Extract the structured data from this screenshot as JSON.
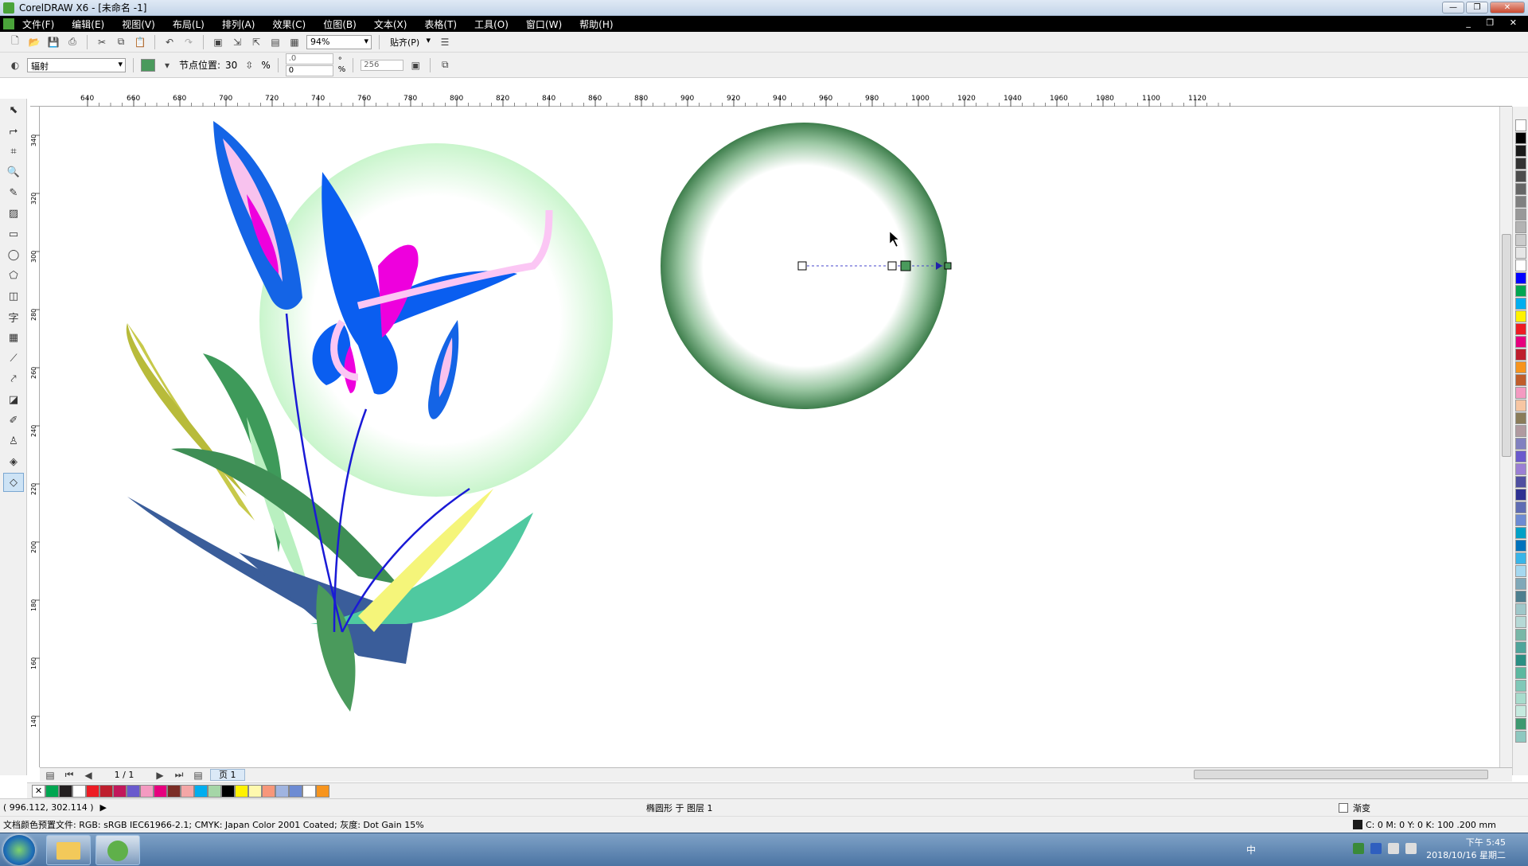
{
  "window": {
    "title": "CorelDRAW X6 - [未命名 -1]",
    "min": "—",
    "max": "❐",
    "close": "✕"
  },
  "menu": [
    "文件(F)",
    "编辑(E)",
    "视图(V)",
    "布局(L)",
    "排列(A)",
    "效果(C)",
    "位图(B)",
    "文本(X)",
    "表格(T)",
    "工具(O)",
    "窗口(W)",
    "帮助(H)"
  ],
  "menu_right": "_ ❐ ✕",
  "toolbar": {
    "zoom": "94%",
    "snap_label": "贴齐(P)"
  },
  "propbar": {
    "fill_type": "辐射",
    "node_label": "节点位置:",
    "node_value": "30",
    "pct": "%",
    "angle": ".0",
    "pad": "0",
    "pad_pct": "%",
    "steps": "256",
    "deg": "°"
  },
  "ruler": {
    "top_ticks": [
      "640",
      "660",
      "680",
      "700",
      "720",
      "740",
      "760",
      "780",
      "800",
      "820",
      "840",
      "860",
      "880",
      "900",
      "920",
      "940",
      "960",
      "980",
      "1000",
      "1020",
      "1040",
      "1060",
      "1080",
      "1100",
      "1120"
    ],
    "left_ticks": [
      "340",
      "320",
      "300",
      "280",
      "260",
      "240",
      "220",
      "200",
      "180",
      "160",
      "140"
    ]
  },
  "pagenav": {
    "counter": "1 / 1",
    "tab": "页 1"
  },
  "status": {
    "coords": "( 996.112, 302.114 )",
    "object": "椭圆形 于 图层 1",
    "fill_label": "渐变",
    "profile": "文档颜色预置文件: RGB: sRGB IEC61966-2.1; CMYK: Japan Color 2001 Coated; 灰度: Dot Gain 15%",
    "outline": "C: 0 M: 0 Y: 0 K: 100  .200 mm"
  },
  "taskbar": {
    "time": "下午 5:45",
    "date": "2018/10/16 星期二",
    "ime": "中"
  },
  "doc_palette": [
    "#00a651",
    "#231f20",
    "#ffffff",
    "#ed1c24",
    "#be1e2d",
    "#c2185b",
    "#6a5acd",
    "#f49ac1",
    "#e6007e",
    "#7b2d26",
    "#f4a6a6",
    "#00aeef",
    "#a5d6a7",
    "#000000",
    "#fff200",
    "#fff9ae",
    "#f7977a",
    "#a0b4e0",
    "#6d8bd3",
    "#ffffff",
    "#f7941d"
  ],
  "color_palette": [
    "#ffffff",
    "#000000",
    "#1a1a1a",
    "#333333",
    "#4d4d4d",
    "#666666",
    "#808080",
    "#999999",
    "#b3b3b3",
    "#cccccc",
    "#e6e6e6",
    "#ffffff",
    "#0000ff",
    "#00a651",
    "#00aeef",
    "#fff200",
    "#ed1c24",
    "#e6007e",
    "#be1e2d",
    "#f7941d",
    "#c05d2a",
    "#f49ac1",
    "#f7c6a3",
    "#8a7c5a",
    "#b09aa0",
    "#8080c0",
    "#6a5acd",
    "#9b7fd4",
    "#4f4fa0",
    "#2e3192",
    "#5f6cb4",
    "#6d8bd3",
    "#00a0c6",
    "#0072bc",
    "#39b5e8",
    "#a5d8f0",
    "#7fa8b8",
    "#4d7f8f",
    "#9fc7c9",
    "#b6d9d6",
    "#78b7a7",
    "#4fa59b",
    "#2a8f83",
    "#5cb8a0",
    "#7fc8b8",
    "#a8dccd",
    "#c6eadf",
    "#3d9970",
    "#8ec8c0"
  ],
  "colors": {
    "accent": "#4a8c5c",
    "bubble": "#c9f5cc"
  }
}
